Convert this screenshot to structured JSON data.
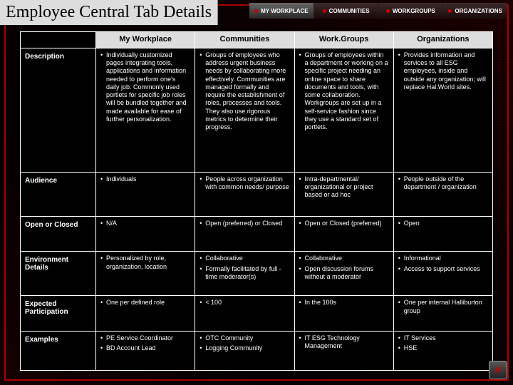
{
  "title": "Employee Central Tab Details",
  "tabs": [
    {
      "label": "MY WORKPLACE",
      "active": true
    },
    {
      "label": "COMMUNITIES",
      "active": false
    },
    {
      "label": "WORKGROUPS",
      "active": false
    },
    {
      "label": "ORGANIZATIONS",
      "active": false
    }
  ],
  "columns": [
    "My Workplace",
    "Communities",
    "Work.Groups",
    "Organizations"
  ],
  "rows": [
    {
      "label": "Description",
      "cells": [
        [
          "Individually customized pages integrating tools, applications and information needed to perform one's daily job. Commonly used portlets for specific job roles will be bundled together and made available for ease of further personalization."
        ],
        [
          "Groups of employees who address urgent business needs by collaborating more effectively.  Communities are managed formally and require the establishment of roles, processes and tools. They also use rigorous metrics to determine their progress."
        ],
        [
          "Groups of employees within a department or working on a specific project needing an online space to share documents and tools, with some collaboration. Workgroups are set up in a self-service fashion since they use a standard set of portlets."
        ],
        [
          "Provides information and services to all ESG employees, inside and outside any organization; will replace Hal.World sites."
        ]
      ]
    },
    {
      "label": "Audience",
      "cells": [
        [
          "Individuals"
        ],
        [
          "People across organization with common needs/ purpose"
        ],
        [
          "Intra-departmental/ organizational or project based or ad hoc"
        ],
        [
          "People outside of the department / organization"
        ]
      ]
    },
    {
      "label": "Open or Closed",
      "cells": [
        [
          "N/A"
        ],
        [
          "Open (preferred) or Closed"
        ],
        [
          "Open or Closed (preferred)"
        ],
        [
          "Open"
        ]
      ]
    },
    {
      "label": "Environment Details",
      "cells": [
        [
          "Personalized by role, organization, location"
        ],
        [
          "Collaborative",
          "Formally facilitated by full -time moderator(s)"
        ],
        [
          "Collaborative",
          "Open discussion forums without a moderator"
        ],
        [
          "Informational",
          "Access to support services"
        ]
      ]
    },
    {
      "label": "Expected Participation",
      "cells": [
        [
          "One per defined role"
        ],
        [
          "< 100"
        ],
        [
          "In the 100s"
        ],
        [
          "One per internal Halliburton group"
        ]
      ]
    },
    {
      "label": "Examples",
      "cells": [
        [
          "PE Service Coordinator",
          "BD Account Lead"
        ],
        [
          "OTC Community",
          "Logging Community"
        ],
        [
          "IT ESG Technology Management"
        ],
        [
          "IT Services",
          "HSE"
        ]
      ]
    }
  ],
  "logo_text": "H"
}
